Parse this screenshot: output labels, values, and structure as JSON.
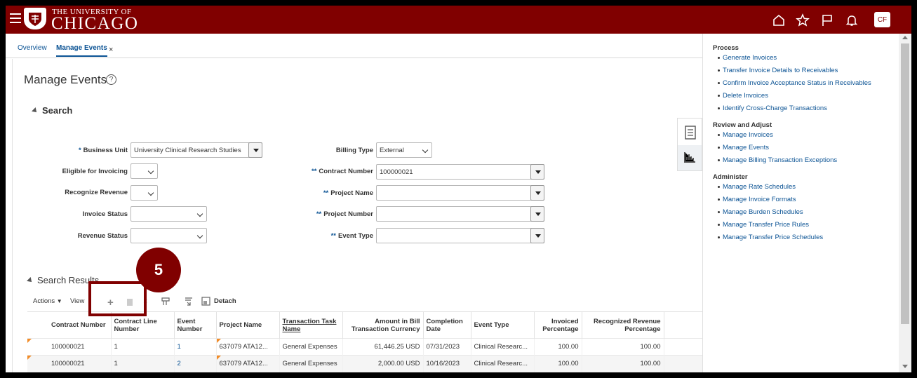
{
  "header": {
    "logo_top": "THE UNIVERSITY OF",
    "logo_main": "CHICAGO",
    "avatar_initials": "CF",
    "brand_color": "#800000"
  },
  "tabs": {
    "overview": "Overview",
    "manage_events": "Manage Events",
    "close": "×"
  },
  "page": {
    "title": "Manage Events",
    "help": "?"
  },
  "search": {
    "title": "Search",
    "business_unit": {
      "label": "Business Unit",
      "value": "University Clinical Research Studies"
    },
    "eligible": {
      "label": "Eligible for Invoicing",
      "value": ""
    },
    "recognize": {
      "label": "Recognize Revenue",
      "value": ""
    },
    "invoice_status": {
      "label": "Invoice Status",
      "value": ""
    },
    "revenue_status": {
      "label": "Revenue Status",
      "value": ""
    },
    "billing_type": {
      "label": "Billing Type",
      "value": "External"
    },
    "contract_number": {
      "label": "Contract Number",
      "value": "100000021"
    },
    "project_name": {
      "label": "Project Name",
      "value": ""
    },
    "project_number": {
      "label": "Project Number",
      "value": ""
    },
    "event_type": {
      "label": "Event Type",
      "value": ""
    },
    "required_marker": "*",
    "conditional_marker": "**"
  },
  "results": {
    "title": "Search Results",
    "actions": "Actions",
    "view": "View",
    "detach": "Detach",
    "callout_number": "5",
    "columns": [
      "Contract Number",
      "Contract Line Number",
      "Event Number",
      "Project Name",
      "Transaction Task Name",
      "Amount in Bill Transaction Currency",
      "Completion Date",
      "Event Type",
      "Invoiced Percentage",
      "Recognized Revenue Percentage"
    ],
    "rows": [
      [
        "100000021",
        "1",
        "1",
        "637079 ATA12...",
        "General Expenses",
        "61,446.25 USD",
        "07/31/2023",
        "Clinical Researc...",
        "100.00",
        "100.00"
      ],
      [
        "100000021",
        "1",
        "2",
        "637079 ATA12...",
        "General Expenses",
        "2,000.00 USD",
        "10/16/2023",
        "Clinical Researc...",
        "100.00",
        "100.00"
      ]
    ]
  },
  "panel": {
    "process_title": "Process",
    "process": [
      "Generate Invoices",
      "Transfer Invoice Details to Receivables",
      "Confirm Invoice Acceptance Status in Receivables",
      "Delete Invoices",
      "Identify Cross-Charge Transactions"
    ],
    "review_title": "Review and Adjust",
    "review": [
      "Manage Invoices",
      "Manage Events",
      "Manage Billing Transaction Exceptions"
    ],
    "admin_title": "Administer",
    "admin": [
      "Manage Rate Schedules",
      "Manage Invoice Formats",
      "Manage Burden Schedules",
      "Manage Transfer Price Rules",
      "Manage Transfer Price Schedules"
    ]
  }
}
